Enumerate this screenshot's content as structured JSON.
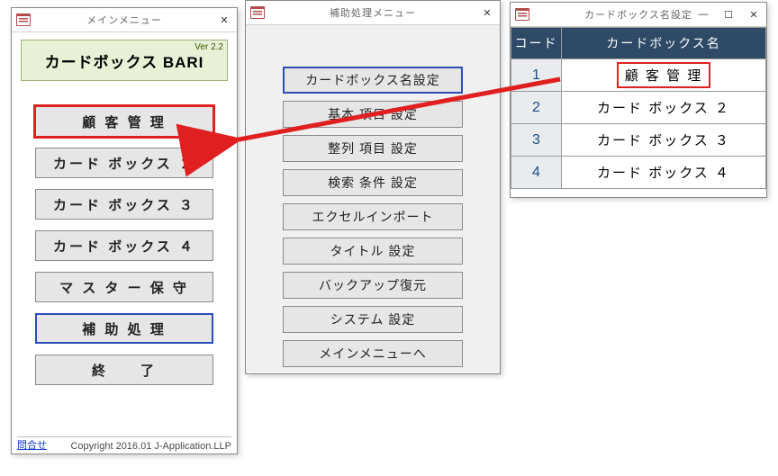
{
  "mainMenu": {
    "windowTitle": "メインメニュー",
    "appTitle": "カードボックス BARI",
    "version": "Ver 2.2",
    "buttons": [
      "顧 客 管 理",
      "カード ボックス ２",
      "カード ボックス ３",
      "カード ボックス ４",
      "マ ス タ ー 保 守",
      "補  助  処  理",
      "終　　了"
    ],
    "inquiry": "問合せ",
    "copyright": "Copyright 2016.01 J-Application.LLP"
  },
  "auxMenu": {
    "windowTitle": "補助処理メニュー",
    "buttons": [
      "カードボックス名設定",
      "基本 項目 設定",
      "整列 項目 設定",
      "検索 条件 設定",
      "エクセルインポート",
      "タイトル 設定",
      "バックアップ復元",
      "システム 設定",
      "メインメニューへ"
    ]
  },
  "tableWin": {
    "windowTitle": "カードボックス名設定",
    "headers": {
      "code": "コード",
      "name": "カードボックス名"
    },
    "rows": [
      {
        "code": "1",
        "name": "顧 客 管 理"
      },
      {
        "code": "2",
        "name": "カード ボックス ２"
      },
      {
        "code": "3",
        "name": "カード ボックス ３"
      },
      {
        "code": "4",
        "name": "カード ボックス ４"
      }
    ]
  },
  "glyphs": {
    "minimize": "—",
    "maximize": "☐",
    "close": "✕"
  }
}
